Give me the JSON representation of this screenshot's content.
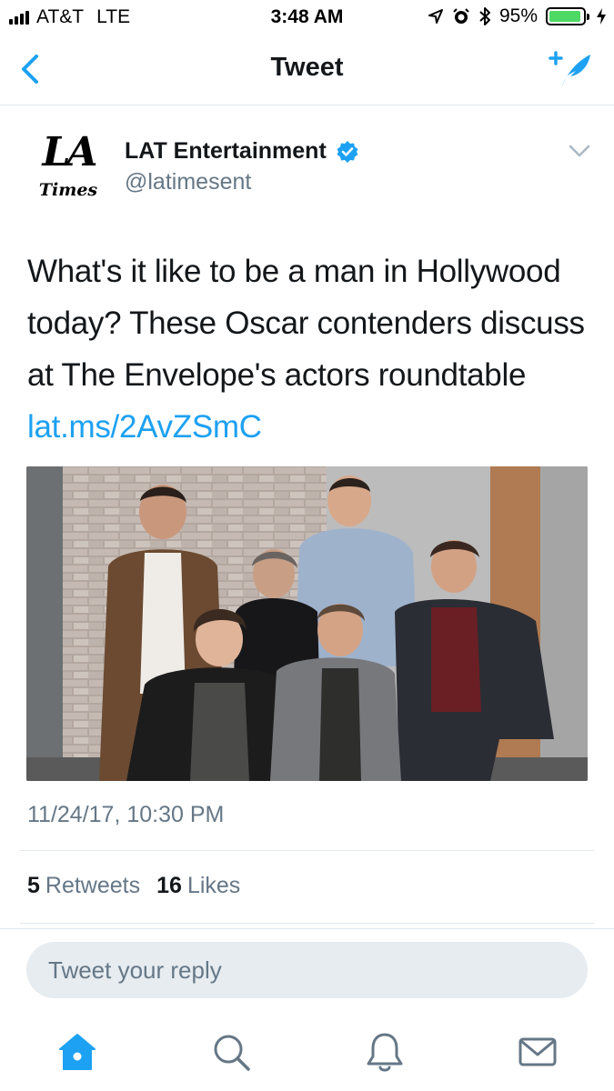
{
  "status_bar": {
    "carrier": "AT&T",
    "network": "LTE",
    "time": "3:48 AM",
    "battery_percent": "95%",
    "battery_level": 0.95
  },
  "nav": {
    "title": "Tweet",
    "back_icon": "chevron-left-icon",
    "compose_icon": "compose-tweet-icon"
  },
  "tweet": {
    "display_name": "LAT Entertainment",
    "handle": "@latimesent",
    "avatar_logo_line1": "LA",
    "avatar_logo_line2": "Times",
    "text": "What's it like to be a man in Hollywood today? These Oscar contenders discuss at The Envelope's actors roundtable ",
    "link": "lat.ms/2AvZSmC",
    "timestamp": "11/24/17, 10:30 PM",
    "retweets_count": "5",
    "retweets_label": "Retweets",
    "likes_count": "16",
    "likes_label": "Likes"
  },
  "reply": {
    "placeholder": "Tweet your reply"
  },
  "tab_bar": {
    "items": [
      "home-icon",
      "search-icon",
      "notifications-bell-icon",
      "messages-envelope-icon"
    ]
  },
  "colors": {
    "accent": "#1da1f2",
    "secondary_text": "#657786",
    "battery": "#4cd964"
  }
}
